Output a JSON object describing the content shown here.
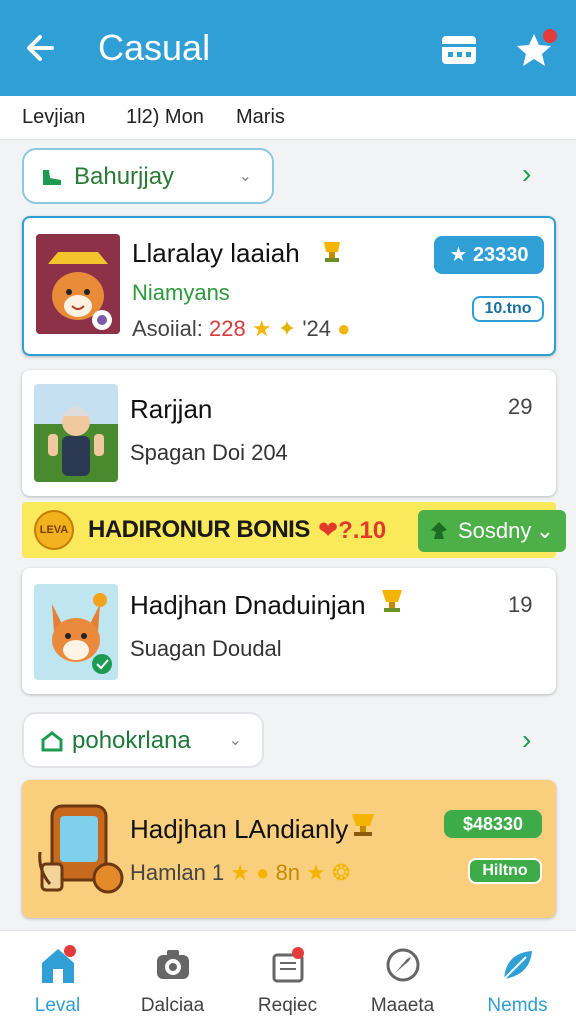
{
  "header": {
    "title": "Casual"
  },
  "tabs": [
    "Levjian",
    "1l2) Mon",
    "Maris"
  ],
  "section1": {
    "label": "Bahurjjay"
  },
  "card1": {
    "name": "Llaralay laaiah",
    "subtitle": "Niamyans",
    "meta_label": "Asoiial:",
    "meta_value": "228",
    "meta_extra": "'24",
    "badge": "23330",
    "badge_small": "10.tno"
  },
  "card2": {
    "name": "Rarjjan",
    "subtitle": "Spagan Doi 204",
    "count": "29"
  },
  "bonus": {
    "text": "HADIRONUR BONIS",
    "counter": "?.10",
    "coin_label": "LEVA",
    "button": "Sosdny"
  },
  "card3": {
    "name": "Hadjhan Dnaduinjan",
    "subtitle": "Suagan Doudal",
    "count": "19"
  },
  "section2": {
    "label": "pohokrlana"
  },
  "card4": {
    "name": "Hadjhan LAndianly",
    "subtitle": "Hamlan 1",
    "meta_value": "8n",
    "badge": "$48330",
    "badge_small": "Hiltno"
  },
  "nav": [
    {
      "label": "Leval",
      "icon": "home-icon"
    },
    {
      "label": "Dalciaa",
      "icon": "camera-icon"
    },
    {
      "label": "Reqiec",
      "icon": "inbox-icon"
    },
    {
      "label": "Maaeta",
      "icon": "compass-icon"
    },
    {
      "label": "Nemds",
      "icon": "leaf-icon"
    }
  ],
  "colors": {
    "header": "#2f9fd6",
    "accent_green": "#1e9b52",
    "badge_blue": "#2f9fd6",
    "bonus_yellow": "#fbe95c",
    "card_orange": "#f9cf7e",
    "active_nav": "#2f9fd6"
  }
}
